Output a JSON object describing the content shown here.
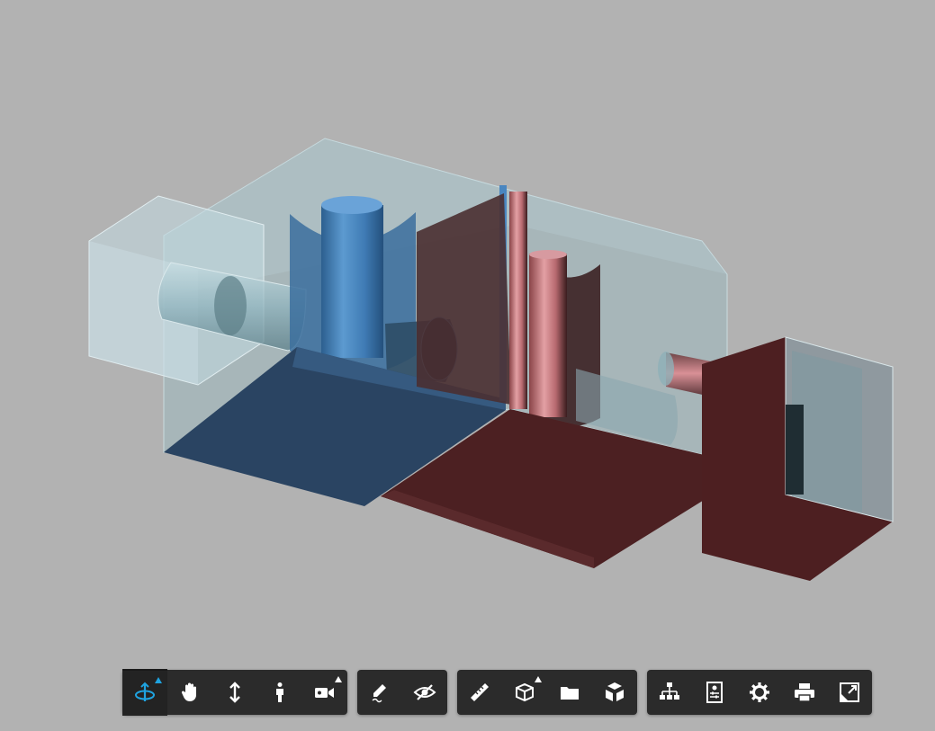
{
  "viewer": {
    "background_color": "#b2b2b2"
  },
  "model": {
    "left_part_color": "#2b4a6e",
    "right_part_color": "#4a2022",
    "glass_color": "#a7c6cf",
    "highlight_blue": "#4a86c0",
    "highlight_red": "#e08a8f"
  },
  "toolbar": {
    "groups": [
      {
        "name": "navigation",
        "tools": [
          {
            "icon": "orbit-icon",
            "active": true,
            "has_submenu": true
          },
          {
            "icon": "pan-hand-icon",
            "active": false,
            "has_submenu": false
          },
          {
            "icon": "zoom-icon",
            "active": false,
            "has_submenu": false
          },
          {
            "icon": "first-person-icon",
            "active": false,
            "has_submenu": false
          },
          {
            "icon": "camera-icon",
            "active": false,
            "has_submenu": true
          }
        ]
      },
      {
        "name": "markup",
        "tools": [
          {
            "icon": "markup-pencil-icon",
            "active": false,
            "has_submenu": false
          },
          {
            "icon": "hide-eye-icon",
            "active": false,
            "has_submenu": false
          }
        ]
      },
      {
        "name": "analysis",
        "tools": [
          {
            "icon": "measure-ruler-icon",
            "active": false,
            "has_submenu": false
          },
          {
            "icon": "section-box-icon",
            "active": false,
            "has_submenu": true
          },
          {
            "icon": "folder-icon",
            "active": false,
            "has_submenu": false
          },
          {
            "icon": "explode-cube-icon",
            "active": false,
            "has_submenu": false
          }
        ]
      },
      {
        "name": "settings",
        "tools": [
          {
            "icon": "model-tree-icon",
            "active": false,
            "has_submenu": false
          },
          {
            "icon": "properties-icon",
            "active": false,
            "has_submenu": false
          },
          {
            "icon": "settings-gear-icon",
            "active": false,
            "has_submenu": false
          },
          {
            "icon": "print-icon",
            "active": false,
            "has_submenu": false
          },
          {
            "icon": "fullscreen-icon",
            "active": false,
            "has_submenu": false
          }
        ]
      }
    ],
    "colors": {
      "background": "#2b2b2b",
      "icon": "#ffffff",
      "active_icon": "#1fa3e0"
    }
  }
}
